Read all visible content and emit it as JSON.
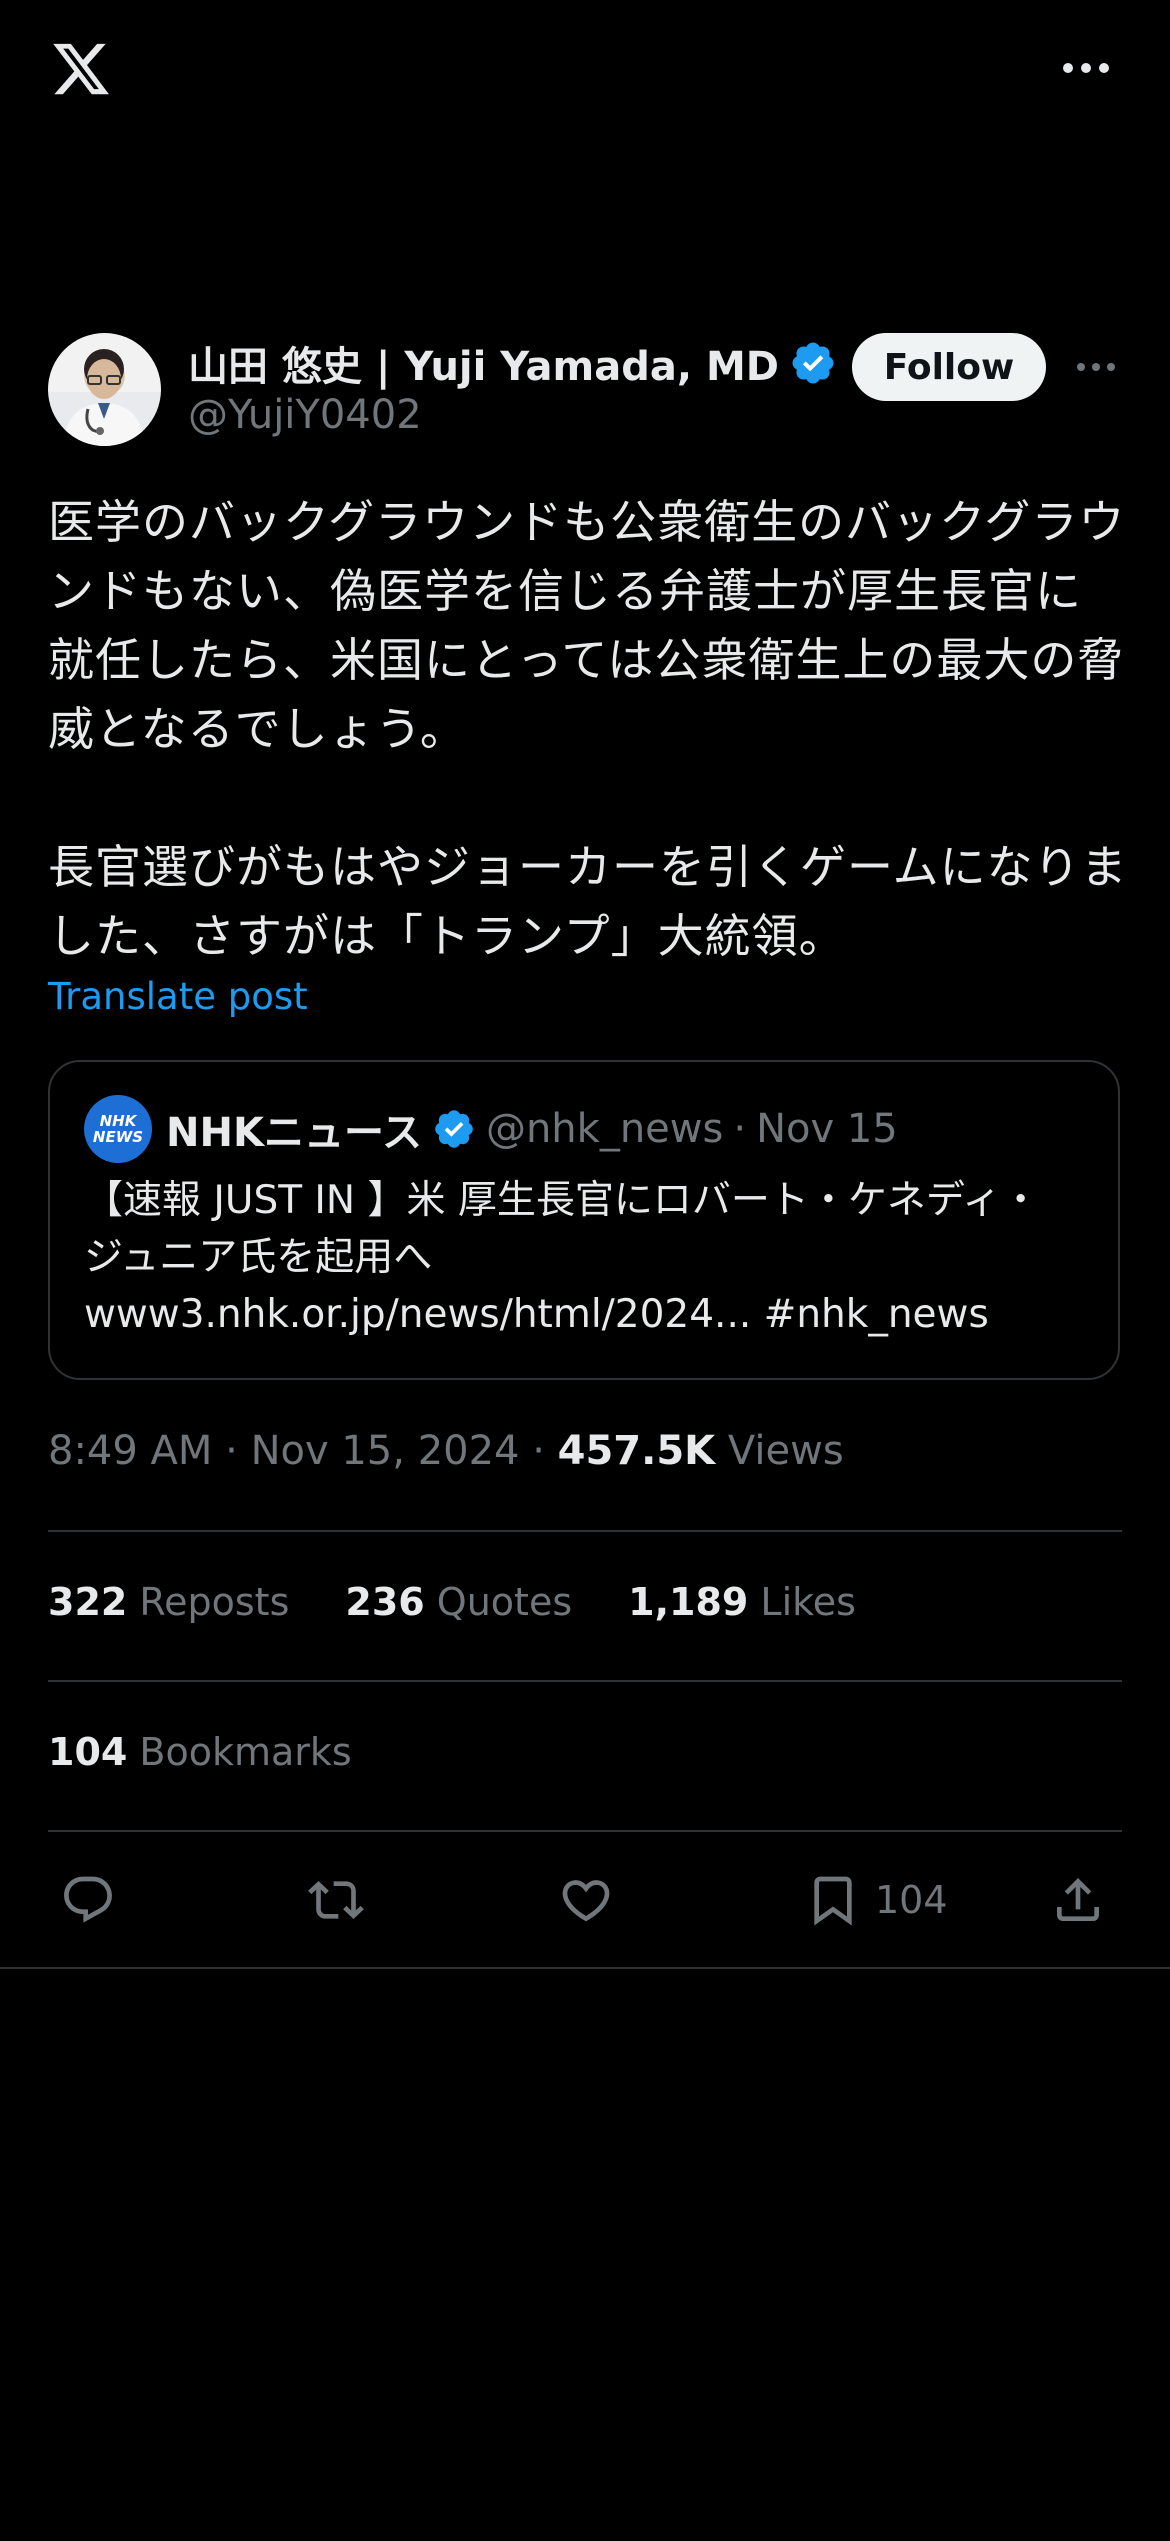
{
  "top_bar": {
    "logo_icon": "x-logo-icon",
    "more_icon": "more-horizontal-icon"
  },
  "author": {
    "display_name": "山田 悠史 | Yuji Yamada, MD",
    "handle": "@YujiY0402",
    "verified_icon": "verified-badge-icon",
    "follow_label": "Follow",
    "more_icon": "more-horizontal-icon"
  },
  "tweet": {
    "text": "医学のバックグラウンドも公衆衛生のバックグラウンドもない、偽医学を信じる弁護士が厚生長官に就任したら、米国にとっては公衆衛生上の最大の脅威となるでしょう。\n\n長官選びがもはやジョーカーを引くゲームになりました、さすがは「トランプ」大統領。",
    "translate_label": "Translate post"
  },
  "quote": {
    "logo_text_top": "NHK",
    "logo_text_bottom": "NEWS",
    "name": "NHKニュース",
    "handle": "@nhk_news",
    "separator": "·",
    "date": "Nov 15",
    "text": "【速報 JUST IN 】米 厚生長官にロバート・ケネディ・ジュニア氏を起用へ\nwww3.nhk.or.jp/news/html/2024... #nhk_news"
  },
  "meta": {
    "time": "8:49 AM",
    "date": "Nov 15, 2024",
    "separator": "·",
    "views_count": "457.5K",
    "views_label": "Views"
  },
  "stats": {
    "reposts_count": "322",
    "reposts_label": "Reposts",
    "quotes_count": "236",
    "quotes_label": "Quotes",
    "likes_count": "1,189",
    "likes_label": "Likes",
    "bookmarks_count": "104",
    "bookmarks_label": "Bookmarks"
  },
  "actions": {
    "reply_icon": "reply-icon",
    "repost_icon": "repost-icon",
    "like_icon": "heart-icon",
    "bookmark_icon": "bookmark-icon",
    "bookmark_count": "104",
    "share_icon": "share-icon"
  },
  "colors": {
    "accent": "#1d9bf0",
    "background": "#000000",
    "text": "#e7e9ea",
    "muted": "#71767b",
    "border": "#2f3336"
  }
}
